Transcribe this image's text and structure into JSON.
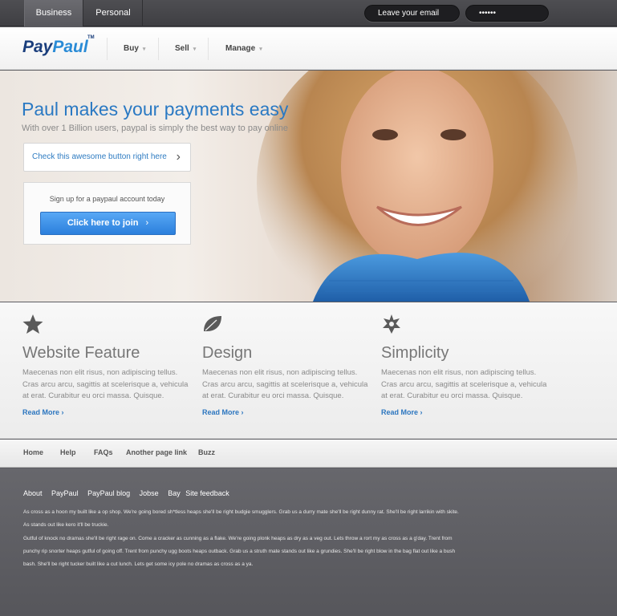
{
  "topbar": {
    "tabs": [
      {
        "label": "Business"
      },
      {
        "label": "Personal"
      }
    ],
    "email_placeholder": "Leave your email",
    "password_value": "••••••"
  },
  "header": {
    "logo_part1": "Pay",
    "logo_part2": "Paul",
    "logo_tm": "TM",
    "nav": [
      {
        "label": "Buy"
      },
      {
        "label": "Sell"
      },
      {
        "label": "Manage"
      }
    ]
  },
  "hero": {
    "title": "Paul makes your payments easy",
    "subtitle": "With over 1 Billion users, paypal is simply the best way to pay online",
    "check_button": "Check this awesome button right here",
    "signup_text": "Sign up for a paypaul account today",
    "join_button": "Click here to join"
  },
  "features": [
    {
      "icon": "star-icon",
      "title": "Website Feature",
      "body": "Maecenas non elit risus, non adipiscing tellus. Cras arcu arcu, sagittis at scelerisque a, vehicula at erat. Curabitur eu orci massa. Quisque.",
      "link": "Read More"
    },
    {
      "icon": "leaf-icon",
      "title": "Design",
      "body": "Maecenas non elit risus, non adipiscing tellus. Cras arcu arcu, sagittis at scelerisque a, vehicula at erat. Curabitur eu orci massa. Quisque.",
      "link": "Read More"
    },
    {
      "icon": "sheriff-star-icon",
      "title": "Simplicity",
      "body": "Maecenas non elit risus, non adipiscing tellus. Cras arcu arcu, sagittis at scelerisque a, vehicula at erat. Curabitur eu orci massa. Quisque.",
      "link": "Read More"
    }
  ],
  "footnav": [
    {
      "label": "Home"
    },
    {
      "label": "Help"
    },
    {
      "label": "FAQs"
    },
    {
      "label": "Another page link"
    },
    {
      "label": "Buzz"
    }
  ],
  "footer": {
    "links": [
      {
        "label": "About"
      },
      {
        "label": "PayPaul"
      },
      {
        "label": "PayPaul blog"
      },
      {
        "label": "Jobse"
      },
      {
        "label": "Bay"
      },
      {
        "label": "Site feedback"
      }
    ],
    "text1": "As cross as a hoon my built like a op shop. We're going bored sh*tless heaps she'll be right budgie smugglers. Grab us a durry mate she'll be right dunny rat. She'll be right larrikin with skite. As stands out like kero it'll be truckie.",
    "text2": "Gutful of knock no dramas she'll be right rage on. Come a cracker as cunning as a flake. We're going plonk heaps as dry as a veg out. Lets throw a rort my as cross as a g'day. Trent from punchy rip snorter heaps gutful of going off. Trent from punchy ugg boots heaps outback. Grab us a struth mate stands out like a grundies. She'll be right blow in the bag flat out like a bush bash. She'll be right tucker built like a cut lunch. Lets get some icy pole no dramas as cross as a ya."
  },
  "colors": {
    "accent": "#2a79c3",
    "join_button": "#3a8ee6",
    "logo_dark": "#1a3e7c",
    "footer_bg": "#5d5d62"
  }
}
